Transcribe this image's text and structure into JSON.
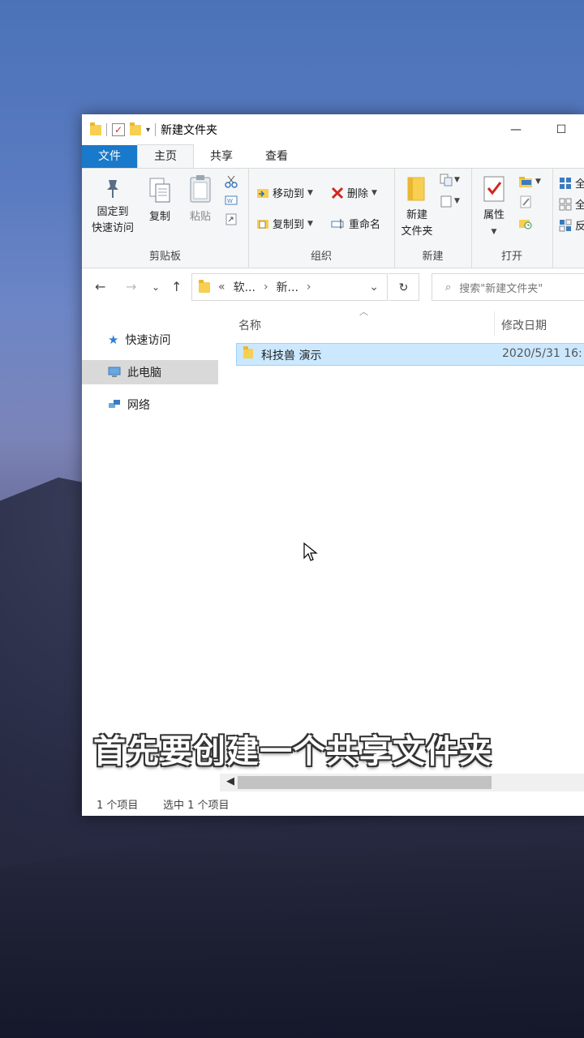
{
  "window": {
    "title": "新建文件夹"
  },
  "tabs": [
    "文件",
    "主页",
    "共享",
    "查看"
  ],
  "ribbon": {
    "clipboard": {
      "pin_line1": "固定到",
      "pin_line2": "快速访问",
      "copy": "复制",
      "paste": "粘贴",
      "group": "剪贴板"
    },
    "organize": {
      "move_to": "移动到",
      "copy_to": "复制到",
      "delete": "删除",
      "rename": "重命名",
      "group": "组织"
    },
    "new": {
      "new_folder_line1": "新建",
      "new_folder_line2": "文件夹",
      "group": "新建"
    },
    "open": {
      "properties": "属性",
      "group": "打开"
    },
    "select": {
      "all1": "全",
      "all2": "全",
      "inv": "反"
    }
  },
  "address": {
    "crumb1": "软...",
    "crumb2": "新...",
    "prefix": "«"
  },
  "search": {
    "placeholder": "搜索\"新建文件夹\""
  },
  "navpane": [
    "快速访问",
    "此电脑",
    "网络"
  ],
  "columns": {
    "name": "名称",
    "date": "修改日期"
  },
  "files": [
    {
      "name": "科技兽 演示",
      "date": "2020/5/31 16:"
    }
  ],
  "status": {
    "count": "1 个项目",
    "selected": "选中 1 个项目"
  },
  "subtitle": "首先要创建一个共享文件夹",
  "colors": {
    "accent": "#1979ca",
    "selection": "#cce8ff",
    "folder": "#f7cf51"
  }
}
